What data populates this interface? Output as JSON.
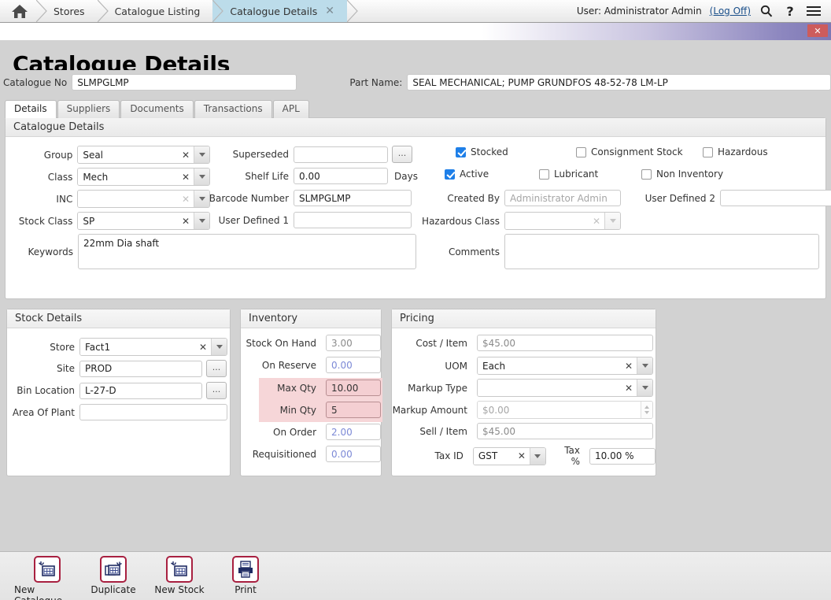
{
  "breadcrumb": {
    "home_icon": "home-icon",
    "items": [
      {
        "label": "Stores",
        "active": false
      },
      {
        "label": "Catalogue Listing",
        "active": false
      },
      {
        "label": "Catalogue Details",
        "active": true,
        "closable": true
      }
    ],
    "close_glyph": "✕"
  },
  "header": {
    "user_text": "User: Administrator Admin",
    "logoff_label": "(Log Off)",
    "search_icon": "search-icon",
    "help_icon": "question-mark-icon",
    "menu_icon": "hamburger-menu-icon",
    "window_close_glyph": "✕",
    "accent_purple": "#7e78b4",
    "close_red": "#cd5c5c"
  },
  "page": {
    "title": "Catalogue Details"
  },
  "top_fields": {
    "catalogue_no_label": "Catalogue No",
    "catalogue_no_value": "SLMPGLMP",
    "part_name_label": "Part Name:",
    "part_name_value": "SEAL MECHANICAL; PUMP GRUNDFOS 48-52-78 LM-LP"
  },
  "tabs": [
    {
      "label": "Details",
      "selected": true
    },
    {
      "label": "Suppliers",
      "selected": false
    },
    {
      "label": "Documents",
      "selected": false
    },
    {
      "label": "Transactions",
      "selected": false
    },
    {
      "label": "APL",
      "selected": false
    }
  ],
  "catalogue_details": {
    "group_title": "Catalogue Details",
    "fields": {
      "group_label": "Group",
      "group_value": "Seal",
      "class_label": "Class",
      "class_value": "Mech",
      "inc_label": "INC",
      "inc_value": "",
      "stock_class_label": "Stock Class",
      "stock_class_value": "SP",
      "keywords_label": "Keywords",
      "keywords_value": "22mm Dia shaft",
      "superseded_label": "Superseded",
      "superseded_value": "",
      "superseded_browse": "...",
      "shelf_life_label": "Shelf Life",
      "shelf_life_value": "0.00",
      "shelf_life_unit": "Days",
      "barcode_label": "Barcode Number",
      "barcode_value": "SLMPGLMP",
      "user_defined_1_label": "User Defined 1",
      "user_defined_1_value": "",
      "created_by_label": "Created By",
      "created_by_value": "Administrator Admin",
      "hazardous_class_label": "Hazardous Class",
      "hazardous_class_value": "",
      "user_defined_2_label": "User Defined 2",
      "user_defined_2_value": "",
      "comments_label": "Comments",
      "comments_value": ""
    },
    "checkboxes": [
      {
        "label": "Stocked",
        "checked": true
      },
      {
        "label": "Consignment Stock",
        "checked": false
      },
      {
        "label": "Hazardous",
        "checked": false
      },
      {
        "label": "Active",
        "checked": true
      },
      {
        "label": "Lubricant",
        "checked": false
      },
      {
        "label": "Non Inventory",
        "checked": false
      }
    ]
  },
  "stock_details": {
    "title": "Stock Details",
    "store_label": "Store",
    "store_value": "Fact1",
    "site_label": "Site",
    "site_value": "PROD",
    "site_browse": "...",
    "bin_location_label": "Bin Location",
    "bin_location_value": "L-27-D",
    "bin_browse": "...",
    "area_of_plant_label": "Area Of Plant",
    "area_of_plant_value": ""
  },
  "inventory": {
    "title": "Inventory",
    "rows": [
      {
        "label": "Stock On Hand",
        "value": "3.00",
        "style": "readonly-grey"
      },
      {
        "label": "On Reserve",
        "value": "0.00",
        "style": "readonly-blue"
      },
      {
        "label": "Max Qty",
        "value": "10.00",
        "style": "highlighted"
      },
      {
        "label": "Min Qty",
        "value": "5",
        "style": "highlighted-focus"
      },
      {
        "label": "On Order",
        "value": "2.00",
        "style": "readonly-blue"
      },
      {
        "label": "Requisitioned",
        "value": "0.00",
        "style": "readonly-blue"
      }
    ],
    "highlight_color": "#f6d6d8"
  },
  "pricing": {
    "title": "Pricing",
    "cost_item_label": "Cost / Item",
    "cost_item_value": "$45.00",
    "uom_label": "UOM",
    "uom_value": "Each",
    "markup_type_label": "Markup Type",
    "markup_type_value": "",
    "markup_amount_label": "Markup Amount",
    "markup_amount_value": "$0.00",
    "sell_item_label": "Sell / Item",
    "sell_item_value": "$45.00",
    "tax_id_label": "Tax ID",
    "tax_id_value": "GST",
    "tax_pct_label": "Tax %",
    "tax_pct_value": "10.00 %"
  },
  "toolbar": [
    {
      "label": "New Catalogue",
      "icon": "new-catalogue-icon"
    },
    {
      "label": "Duplicate",
      "icon": "duplicate-icon"
    },
    {
      "label": "New Stock",
      "icon": "new-stock-icon"
    },
    {
      "label": "Print",
      "icon": "printer-icon"
    }
  ]
}
